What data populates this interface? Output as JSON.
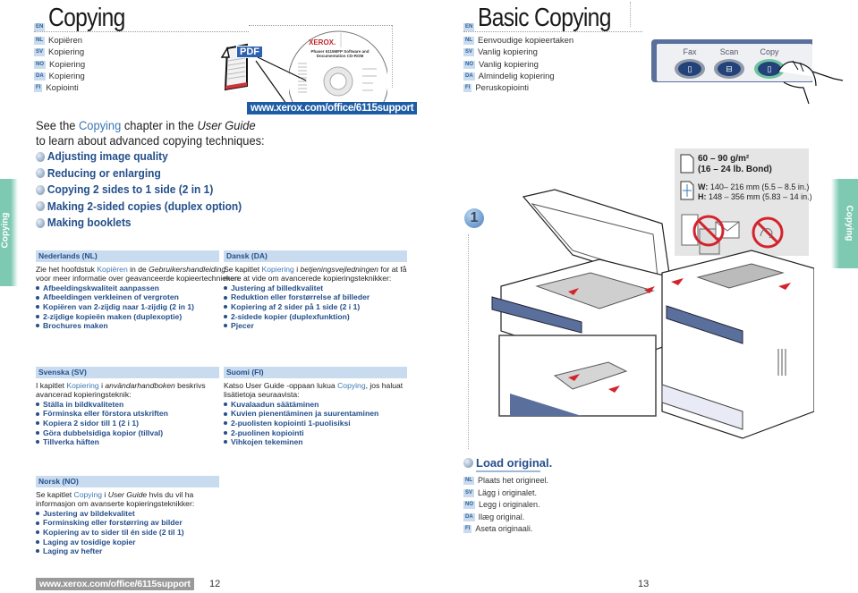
{
  "left_page": {
    "title": {
      "lang": "EN",
      "text": "Copying"
    },
    "translations": [
      {
        "lang": "NL",
        "text": "Kopiëren"
      },
      {
        "lang": "SV",
        "text": "Kopiering"
      },
      {
        "lang": "NO",
        "text": "Kopiering"
      },
      {
        "lang": "DA",
        "text": "Kopiering"
      },
      {
        "lang": "FI",
        "text": "Kopiointi"
      }
    ],
    "pdf_icon_label": "PDF",
    "cd": {
      "brand": "XEROX.",
      "title_line1": "Phaser 6115MFP Software and",
      "title_line2": "Documentation CD-ROM"
    },
    "support_url": "www.xerox.com/office/6115support",
    "intro": {
      "line1_pre": "See the ",
      "line1_link": "Copying",
      "line1_mid": " chapter in the ",
      "line1_italic": "User Guide",
      "line2": "to learn about advanced copying techniques:"
    },
    "features": [
      "Adjusting image quality",
      "Reducing or enlarging",
      "Copying 2 sides to 1 side (2 in 1)",
      "Making 2-sided copies (duplex option)",
      "Making booklets"
    ],
    "side_tab": "Copying",
    "languages": {
      "nl": {
        "header": "Nederlands (NL)",
        "pre": "Zie het hoofdstuk ",
        "link": "Kopiëren",
        "mid": " in de ",
        "italic": "Gebruikershandleiding",
        "post": "voor meer informatie over geavanceerde kopieertechnieken:",
        "items": [
          "Afbeeldingskwaliteit aanpassen",
          "Afbeeldingen verkleinen of vergroten",
          "Kopiëren van 2-zijdig naar 1-zijdig (2 in 1)",
          "2-zijdige kopieën maken (duplexoptie)",
          "Brochures maken"
        ]
      },
      "da": {
        "header": "Dansk (DA)",
        "pre": "Se kapitlet ",
        "link": "Kopiering",
        "mid": " i ",
        "italic": "betjeningsvejledningen",
        "post_inline": " for at få",
        "post": "mere at vide om avancerede kopieringsteknikker:",
        "items": [
          "Justering af billedkvalitet",
          "Reduktion eller forstørrelse af billeder",
          "Kopiering af 2 sider på 1 side (2 i 1)",
          "2-sidede kopier (duplexfunktion)",
          "Pjecer"
        ]
      },
      "sv": {
        "header": "Svenska (SV)",
        "pre": "I kapitlet ",
        "link": "Kopiering",
        "mid": " i ",
        "italic": "användarhandboken",
        "post_inline": " beskrivs",
        "post": "avancerad kopieringsteknik:",
        "items": [
          "Ställa in bildkvaliteten",
          "Förminska eller förstora utskriften",
          "Kopiera 2 sidor till 1 (2 i 1)",
          "Göra dubbelsidiga kopior (tillval)",
          "Tillverka häften"
        ]
      },
      "fi": {
        "header": "Suomi (FI)",
        "pre": "Katso User Guide -oppaan lukua ",
        "link": "Copying",
        "post_inline": ", jos haluat",
        "post": "lisätietoja seuraavista:",
        "items": [
          "Kuvalaadun säätäminen",
          "Kuvien pienentäminen ja suurentaminen",
          "2-puolisten kopiointi 1-puolisiksi",
          "2-puolinen kopiointi",
          "Vihkojen tekeminen"
        ]
      },
      "no": {
        "header": "Norsk (NO)",
        "pre": "Se kapitlet ",
        "link": "Copying",
        "mid": " i ",
        "italic": "User Guide",
        "post_inline": " hvis du vil ha",
        "post": "informasjon om avanserte kopieringsteknikker:",
        "items": [
          "Justering av bildekvalitet",
          "Forminsking eller forstørring av bilder",
          "Kopiering av to sider til én side (2 til 1)",
          "Laging av tosidige kopier",
          "Laging av hefter"
        ]
      }
    },
    "footer_url": "www.xerox.com/office/6115support",
    "page_number": "12"
  },
  "right_page": {
    "title": {
      "lang": "EN",
      "text": "Basic Copying"
    },
    "translations": [
      {
        "lang": "NL",
        "text": "Eenvoudige kopieertaken"
      },
      {
        "lang": "SV",
        "text": "Vanlig kopiering"
      },
      {
        "lang": "NO",
        "text": "Vanlig kopiering"
      },
      {
        "lang": "DA",
        "text": "Almindelig kopiering"
      },
      {
        "lang": "FI",
        "text": "Peruskopiointi"
      }
    ],
    "control_panel": {
      "buttons": [
        {
          "label": "Fax",
          "icon": "fax-icon",
          "active": false
        },
        {
          "label": "Scan",
          "icon": "scan-icon",
          "active": false
        },
        {
          "label": "Copy",
          "icon": "copy-icon",
          "active": true
        }
      ]
    },
    "specs": {
      "weight_line1": "60 – 90 g/m²",
      "weight_line2": "(16 – 24 lb. Bond)",
      "width_label": "W:",
      "width_value": "140– 216 mm (5.5 – 8.5 in.)",
      "height_label": "H:",
      "height_value": "148 – 356 mm (5.83 – 14 in.)"
    },
    "step": {
      "number": "1",
      "title": "Load original.",
      "translations": [
        {
          "lang": "NL",
          "text": "Plaats het origineel."
        },
        {
          "lang": "SV",
          "text": "Lägg i originalet."
        },
        {
          "lang": "NO",
          "text": "Legg i originalen."
        },
        {
          "lang": "DA",
          "text": "Ilæg original."
        },
        {
          "lang": "FI",
          "text": "Aseta originaali."
        }
      ]
    },
    "side_tab": "Copying",
    "page_number": "13"
  },
  "colors": {
    "accent_blue": "#244f8a",
    "link_blue": "#3b78b5",
    "tag_bg": "#c9dcef",
    "tab_green": "#7ec9b2",
    "url_bg": "#1d5ca4"
  }
}
